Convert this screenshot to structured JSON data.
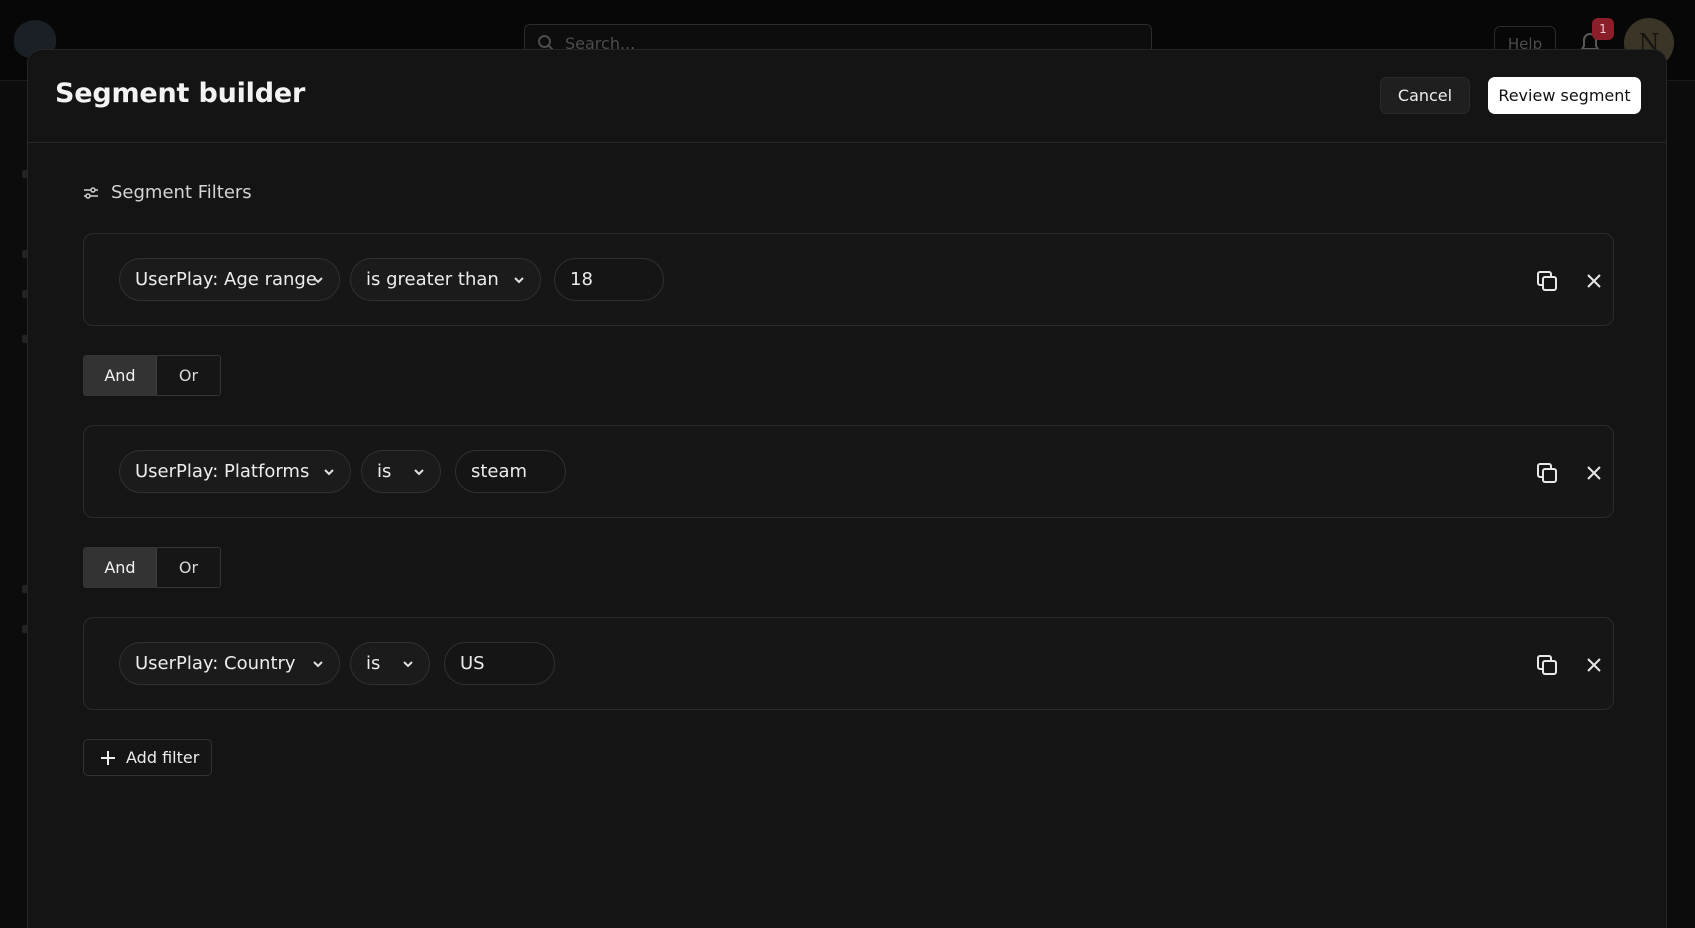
{
  "background": {
    "search_placeholder": "Search...",
    "help_label": "Help",
    "notification_count": "1",
    "avatar_initial": "N"
  },
  "modal": {
    "title": "Segment builder",
    "cancel_label": "Cancel",
    "review_label": "Review segment",
    "section_title": "Segment Filters",
    "add_filter_label": "Add filter"
  },
  "filters": [
    {
      "property": "UserPlay: Age range",
      "operator": "is greater than",
      "value": "18"
    },
    {
      "property": "UserPlay: Platforms",
      "operator": "is",
      "value": "steam"
    },
    {
      "property": "UserPlay: Country",
      "operator": "is",
      "value": "US"
    }
  ],
  "connectors": [
    {
      "and_label": "And",
      "or_label": "Or",
      "selected": "And"
    },
    {
      "and_label": "And",
      "or_label": "Or",
      "selected": "And"
    }
  ],
  "icons": {
    "filters": "sliders-icon",
    "duplicate": "duplicate-icon",
    "remove": "close-icon",
    "dropdown": "chevron-down-icon",
    "add": "plus-icon"
  }
}
